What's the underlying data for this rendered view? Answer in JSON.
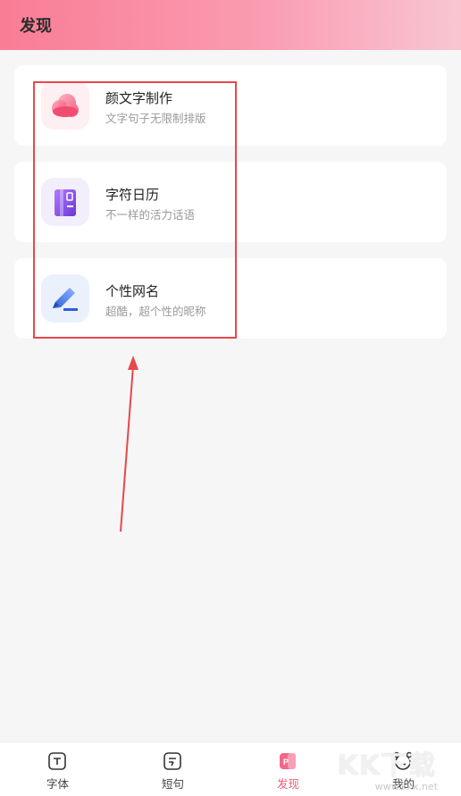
{
  "header": {
    "title": "发现"
  },
  "cards": [
    {
      "name": "颜文字制作",
      "desc": "文字句子无限制排版",
      "icon": "cloud-bubble-icon",
      "color": "#f45b7d"
    },
    {
      "name": "字符日历",
      "desc": "不一样的活力话语",
      "icon": "calendar-book-icon",
      "color": "#8c55e6"
    },
    {
      "name": "个性网名",
      "desc": "超酷，超个性的昵称",
      "icon": "pen-icon",
      "color": "#3a73e0"
    }
  ],
  "tabs": [
    {
      "label": "字体",
      "icon": "font-icon",
      "active": false
    },
    {
      "label": "短句",
      "icon": "note-icon",
      "active": false
    },
    {
      "label": "发现",
      "icon": "discover-icon",
      "active": true
    },
    {
      "label": "我的",
      "icon": "profile-icon",
      "active": false
    }
  ],
  "watermark": {
    "text": "KK下载",
    "url": "www.kkx.net"
  },
  "colors": {
    "accent": "#ef5d79",
    "annotation": "#e8474b"
  }
}
